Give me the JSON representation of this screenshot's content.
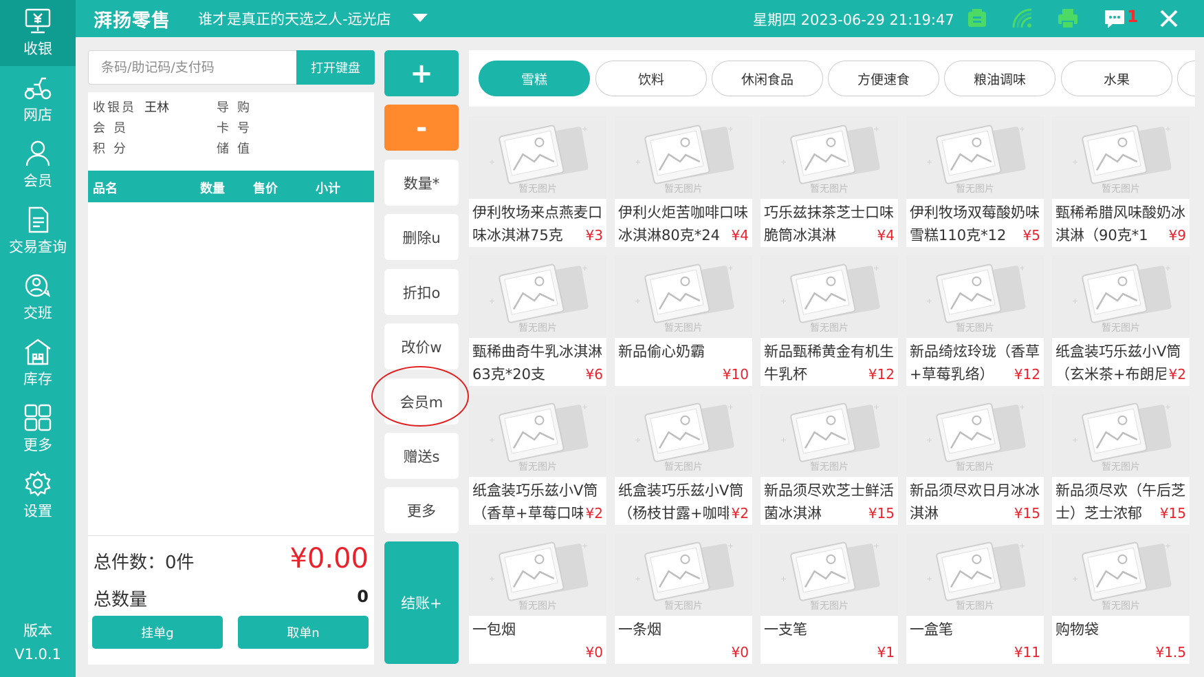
{
  "sidebar": {
    "items": [
      {
        "label": "收银",
        "icon": "cashier-icon",
        "active": true
      },
      {
        "label": "网店",
        "icon": "delivery-icon"
      },
      {
        "label": "会员",
        "icon": "user-icon"
      },
      {
        "label": "交易查询",
        "icon": "document-icon"
      },
      {
        "label": "交班",
        "icon": "shift-icon"
      },
      {
        "label": "库存",
        "icon": "warehouse-icon"
      },
      {
        "label": "更多",
        "icon": "grid-icon"
      },
      {
        "label": "设置",
        "icon": "gear-icon"
      }
    ],
    "version_label": "版本",
    "version_value": "V1.0.1"
  },
  "header": {
    "brand": "湃扬零售",
    "store": "谁才是真正的天选之人-远光店",
    "datetime": "星期四 2023-06-29 21:19:47",
    "notification_count": "1",
    "icons": [
      "receipt-icon",
      "wifi-icon",
      "printer-icon",
      "message-icon",
      "close-icon"
    ]
  },
  "scan": {
    "placeholder": "条码/助记码/支付码",
    "keyboard_button": "打开键盘"
  },
  "info": {
    "cashier_label": "收银员",
    "cashier_value": "王林",
    "guide_label": "导购",
    "member_label": "会员",
    "card_label": "卡号",
    "points_label": "积分",
    "balance_label": "储值"
  },
  "table": {
    "columns": [
      "品名",
      "数量",
      "售价",
      "小计"
    ],
    "rows": []
  },
  "totals": {
    "count_label": "总件数：0件",
    "amount": "¥0.00",
    "qty_label": "总数量",
    "qty_value": "0",
    "hold_button": "挂单g",
    "retrieve_button": "取单n"
  },
  "actions": {
    "plus": "+",
    "minus": "-",
    "quantity": "数量*",
    "delete": "删除u",
    "discount": "折扣o",
    "change_price": "改价w",
    "member": "会员m",
    "gift": "赠送s",
    "more": "更多",
    "checkout": "结账+"
  },
  "categories": [
    {
      "label": "雪糕",
      "active": true
    },
    {
      "label": "饮料"
    },
    {
      "label": "休闲食品"
    },
    {
      "label": "方便速食"
    },
    {
      "label": "粮油调味"
    },
    {
      "label": "水果"
    }
  ],
  "placeholder_text": "暂无图片",
  "products": [
    {
      "name": "伊利牧场来点燕麦口味冰淇淋75克",
      "price": "¥3"
    },
    {
      "name": "伊利火炬苦咖啡口味冰淇淋80克*24",
      "price": "¥4"
    },
    {
      "name": "巧乐兹抹茶芝士口味脆筒冰淇淋",
      "price": "¥4"
    },
    {
      "name": "伊利牧场双莓酸奶味雪糕110克*12",
      "price": "¥5"
    },
    {
      "name": "甄稀希腊风味酸奶冰淇淋（90克*1",
      "price": "¥9"
    },
    {
      "name": "甄稀曲奇牛乳冰淇淋63克*20支",
      "price": "¥6"
    },
    {
      "name": "新品偷心奶霸",
      "price": "¥10"
    },
    {
      "name": "新品甄稀黄金有机生牛乳杯",
      "price": "¥12"
    },
    {
      "name": "新品绮炫玲珑（香草+草莓乳络）",
      "price": "¥12"
    },
    {
      "name": "纸盒装巧乐兹小V筒（玄米茶+布朗尼",
      "price": "¥2"
    },
    {
      "name": "纸盒装巧乐兹小V筒（香草+草莓口味",
      "price": "¥2"
    },
    {
      "name": "纸盒装巧乐兹小V筒（杨枝甘露+咖啡",
      "price": "¥2"
    },
    {
      "name": "新品须尽欢芝士鲜活菌冰淇淋",
      "price": "¥15"
    },
    {
      "name": "新品须尽欢日月冰冰淇淋",
      "price": "¥15"
    },
    {
      "name": "新品须尽欢（午后芝士）芝士浓郁",
      "price": "¥15"
    },
    {
      "name": "一包烟",
      "price": "¥0"
    },
    {
      "name": "一条烟",
      "price": "¥0"
    },
    {
      "name": "一支笔",
      "price": "¥1"
    },
    {
      "name": "一盒笔",
      "price": "¥11"
    },
    {
      "name": "购物袋",
      "price": "¥1.5"
    }
  ],
  "colors": {
    "primary": "#1bb5a9",
    "primary_dark": "#0f9c91",
    "accent_orange": "#ff8a2e",
    "price_red": "#e8232c",
    "notification_red": "#ff2b2b",
    "highlight_circle": "#e02020"
  }
}
